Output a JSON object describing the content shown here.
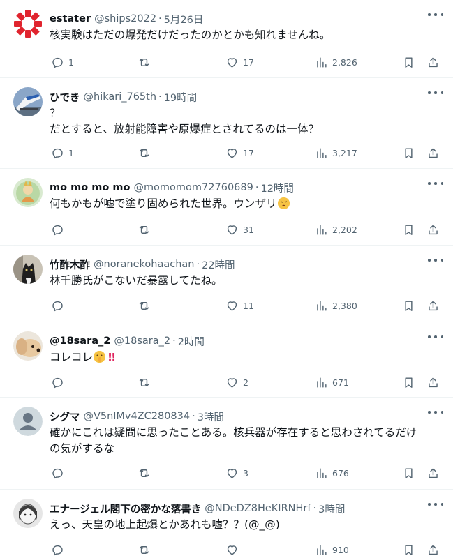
{
  "colors": {
    "text": "#0f1419",
    "secondary": "#536471",
    "divider": "#eff3f4"
  },
  "icons": [
    "reply-icon",
    "retweet-icon",
    "like-icon",
    "views-icon",
    "bookmark-icon",
    "share-icon",
    "more-icon"
  ],
  "tweets": [
    {
      "name": "estater",
      "handle": "@ships2022",
      "time": "5月26日",
      "lines": [
        "核実験はただの爆発だけだったのかとかも知れませんね。"
      ],
      "replies": "1",
      "retweets": "",
      "likes": "17",
      "views": "2,826"
    },
    {
      "name": "ひでき",
      "handle": "@hikari_765th",
      "time": "19時間",
      "lines": [
        "？",
        "だとすると、放射能障害や原爆症とされてるのは一体？"
      ],
      "replies": "1",
      "retweets": "",
      "likes": "17",
      "views": "3,217"
    },
    {
      "name": "mo mo mo mo",
      "handle": "@momomom72760689",
      "time": "12時間",
      "lines": [
        "何もかもが嘘で塗り固められた世界。ウンザリ"
      ],
      "replies": "",
      "retweets": "",
      "likes": "31",
      "views": "2,202"
    },
    {
      "name": "竹酢木酢",
      "handle": "@noranekohaachan",
      "time": "22時間",
      "lines": [
        "林千勝氏がこないだ暴露してたね。"
      ],
      "replies": "",
      "retweets": "",
      "likes": "11",
      "views": "2,380"
    },
    {
      "name": "@18sara_2",
      "handle": "@18sara_2",
      "time": "2時間",
      "lines": [
        "コレコレ"
      ],
      "replies": "",
      "retweets": "",
      "likes": "2",
      "views": "671"
    },
    {
      "name": "シグマ",
      "handle": "@V5nlMv4ZC280834",
      "time": "3時間",
      "lines": [
        "確かにこれは疑問に思ったことある。核兵器が存在すると思わされてるだけ",
        "の気がするな"
      ],
      "replies": "",
      "retweets": "",
      "likes": "3",
      "views": "676"
    },
    {
      "name": "エナージェル閣下の密かな落書き",
      "handle": "@NDeDZ8HeKIRNHrf",
      "time": "3時間",
      "lines": [
        "えっ、天皇の地上起爆とかあれも嘘？？(@_@)"
      ],
      "replies": "",
      "retweets": "",
      "likes": "",
      "views": "910"
    }
  ]
}
